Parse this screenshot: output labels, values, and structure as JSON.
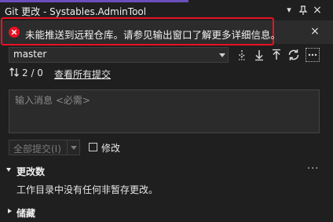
{
  "window": {
    "title": "Git 更改 - Systables.AdminTool",
    "pin_glyph": "▾",
    "pin_icon": "pin-icon",
    "close_glyph": "×"
  },
  "error_bar": {
    "message": "未能推送到远程仓库。请参见输出窗口了解更多详细信息。",
    "icon": "error-icon",
    "close_glyph": "×",
    "accent_color": "#e81123"
  },
  "branch": {
    "selected": "master",
    "actions": [
      "fetch-icon",
      "pull-icon",
      "push-icon",
      "sync-icon",
      "more-icon"
    ]
  },
  "sync_status": {
    "counts": "2 / 0",
    "view_link": "查看所有提交"
  },
  "commit": {
    "message_placeholder": "输入消息 <必需>",
    "commit_all_label": "全部提交(I)",
    "amend_label": "修改"
  },
  "sections": {
    "changes": {
      "title": "更改数",
      "more": "···",
      "empty_text": "工作目录中没有任何非暂存更改。"
    },
    "stashes": {
      "title": "储藏"
    }
  },
  "colors": {
    "background": "#1f1f1f",
    "title_accent": "#6b4fbb",
    "error_red": "#e81123"
  }
}
